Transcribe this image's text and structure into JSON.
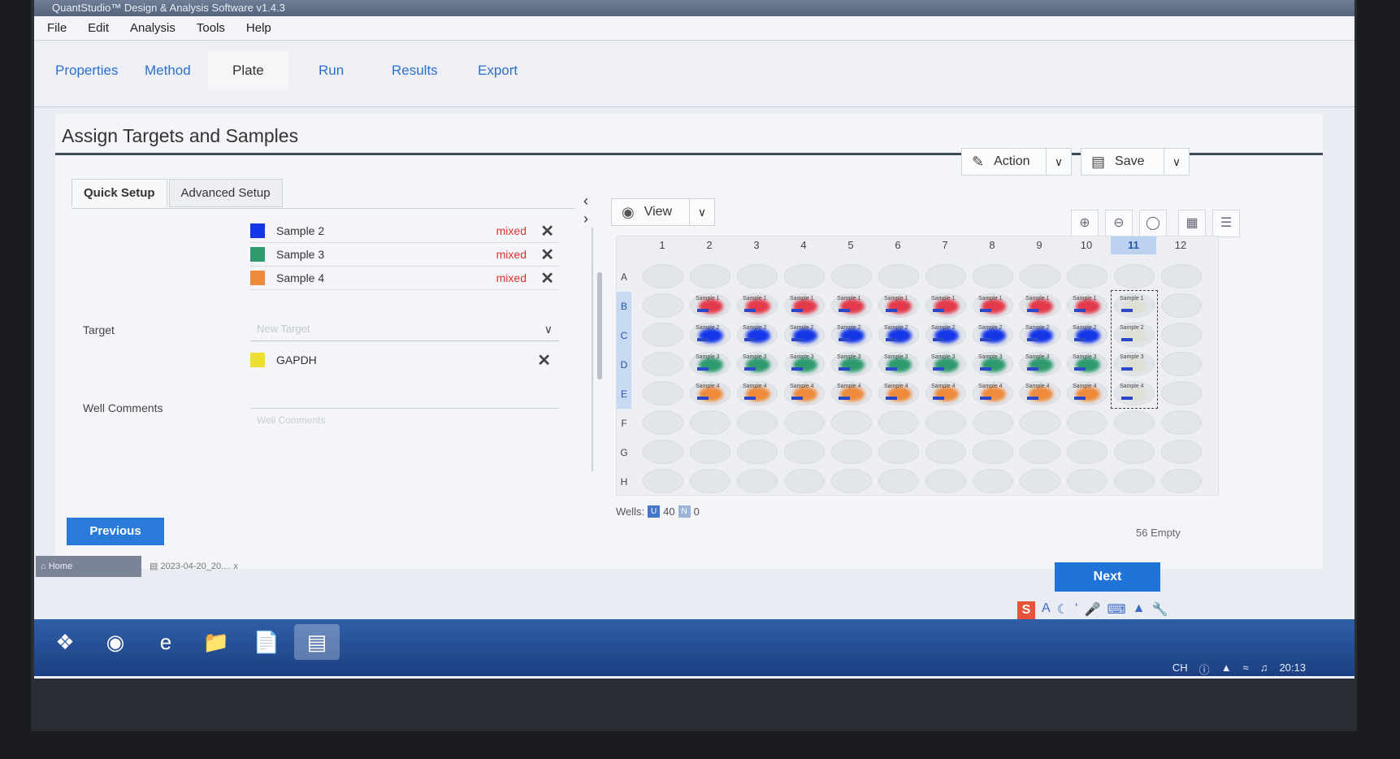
{
  "window": {
    "title": "QuantStudio™ Design & Analysis Software v1.4.3",
    "min_icon": "minimize-icon",
    "max_icon": "maximize-icon",
    "close_icon": "close-icon"
  },
  "menu": [
    "File",
    "Edit",
    "Analysis",
    "Tools",
    "Help"
  ],
  "nav_tabs": [
    "Properties",
    "Method",
    "Plate",
    "Run",
    "Results",
    "Export"
  ],
  "page": {
    "title": "Assign Targets and Samples",
    "action_label": "Action",
    "save_label": "Save"
  },
  "setup_tabs": [
    "Quick Setup",
    "Advanced Setup"
  ],
  "samples": [
    {
      "name": "Sample 2",
      "status": "mixed",
      "color": "#1436e6"
    },
    {
      "name": "Sample 3",
      "status": "mixed",
      "color": "#2e9a6d"
    },
    {
      "name": "Sample 4",
      "status": "mixed",
      "color": "#ee8a3c"
    }
  ],
  "target": {
    "label": "Target",
    "placeholder": "New Target",
    "item": {
      "name": "GAPDH",
      "color": "#eedd33"
    }
  },
  "comments": {
    "label": "Well Comments",
    "placeholder": "Well Comments"
  },
  "view_label": "View",
  "plate": {
    "columns": [
      "1",
      "2",
      "3",
      "4",
      "5",
      "6",
      "7",
      "8",
      "9",
      "10",
      "11",
      "12"
    ],
    "rows": [
      "A",
      "B",
      "C",
      "D",
      "E",
      "F",
      "G",
      "H"
    ],
    "selected_column": "11",
    "well_tags": {
      "B": "Sample 1",
      "C": "Sample 2",
      "D": "Sample 3",
      "E": "Sample 4"
    }
  },
  "wells_footer": {
    "label": "Wells:",
    "u_icon": "U",
    "u_count": "40",
    "n_icon": "N",
    "n_count": "0"
  },
  "empty_text": "56 Empty",
  "previous_label": "Previous",
  "next_label": "Next",
  "home_tab": "Home",
  "file_tab": "2023-04-20_20....",
  "file_close": "x",
  "tray": {
    "ime": "S",
    "lang": "CH",
    "time": "20:13"
  }
}
